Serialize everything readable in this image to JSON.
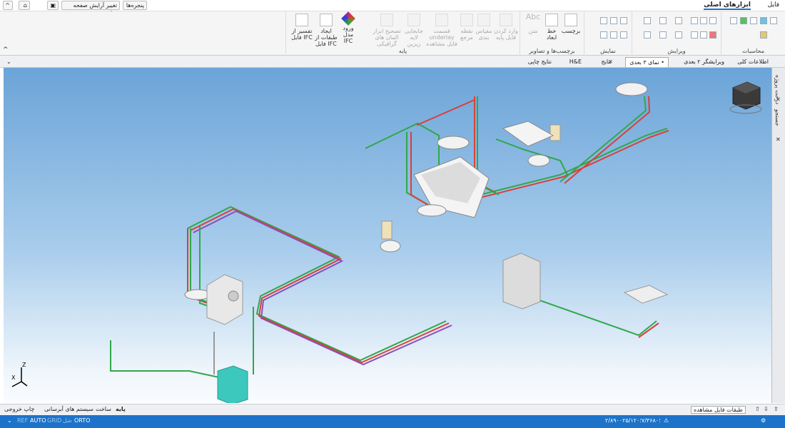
{
  "menubar": {
    "file": "فایل",
    "main_tools": "ابزارهای اصلی",
    "windows": "پنجره‌ها",
    "change_layout": "تغییر آرایش صفحه نمایش"
  },
  "ribbon": {
    "groups": {
      "calculations": "محاسبات",
      "edit": "ویرایش",
      "display": "نمایش",
      "labels_images": "برچسب‌ها و تصاویر",
      "base": "پایه"
    },
    "buttons": {
      "label": "برچسب",
      "line_dimension": "خط ابعاد",
      "text": "متن",
      "import_base": "وارد کردن فایل پایه",
      "scale": "مقیاس بندی",
      "ref_point": "نقطه مرجع",
      "underlay_part": "قسمت underlay فایل مشاهده",
      "move_underlay": "جابجایی لایه زیرین",
      "fix_elements": "تصحیح ابزار المان های گرافیکی",
      "ifc_import": "ورود مدل IFC",
      "create_layers": "ایجاد طبقات از فایل IFC",
      "interpret_ifc": "تفسیر از فایل IFC",
      "abc_text": "Abc"
    }
  },
  "doc_tabs": {
    "general_info": "اطلاعات کلی",
    "editor_2d": "ویرایشگر ۲ بعدی",
    "view_3d": "• نمای ۳ بعدی",
    "results": "نتایج",
    "he": "H&E",
    "print_results": "نتایج چاپی"
  },
  "side_panel": {
    "project_tree": "درخت پروژه",
    "search": "جستجو"
  },
  "layer_tabs": {
    "base": "پایه",
    "building": "ساخت",
    "water_systems": "سیستم های آبرسانی",
    "print_output": "چاپ خروجی",
    "view_layers": "طبقات فایل مشاهده"
  },
  "status": {
    "ref": "REF",
    "auto": "AUTO",
    "grid": "GRID",
    "shell": "شل",
    "orto": "ORTO",
    "coordinates": "۲/۸۹۰۰؛۷/۳۶۸۰؛۲۵/۱۲۰"
  },
  "axes": {
    "z": "Z",
    "x": "X"
  },
  "colors": {
    "accent_blue": "#1d73c9",
    "pipe_green": "#2fa84a",
    "pipe_red": "#d8403c",
    "pipe_purple": "#8c4fb8"
  }
}
